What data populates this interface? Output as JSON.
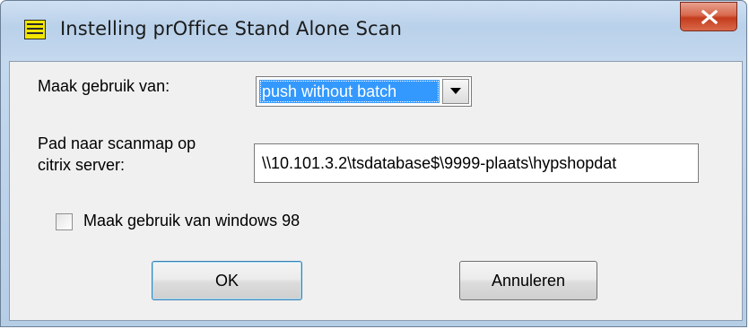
{
  "window": {
    "title": "Instelling prOffice Stand Alone Scan",
    "icons": {
      "app": "form-list-icon",
      "close": "close-x-icon"
    }
  },
  "form": {
    "mode_label": "Maak gebruik van:",
    "mode_selected": "push without batch",
    "path_label_line1": "Pad naar scanmap op",
    "path_label_line2": "citrix server:",
    "path_value": "\\\\10.101.3.2\\tsdatabase$\\9999-plaats\\hypshopdat",
    "win98_label": "Maak gebruik van windows 98",
    "win98_checked": false
  },
  "buttons": {
    "ok": "OK",
    "cancel": "Annuleren"
  },
  "colors": {
    "selection": "#3399ff",
    "close_button": "#c43c1d",
    "frame": "#b9d1ea",
    "client": "#f0f0f0"
  }
}
